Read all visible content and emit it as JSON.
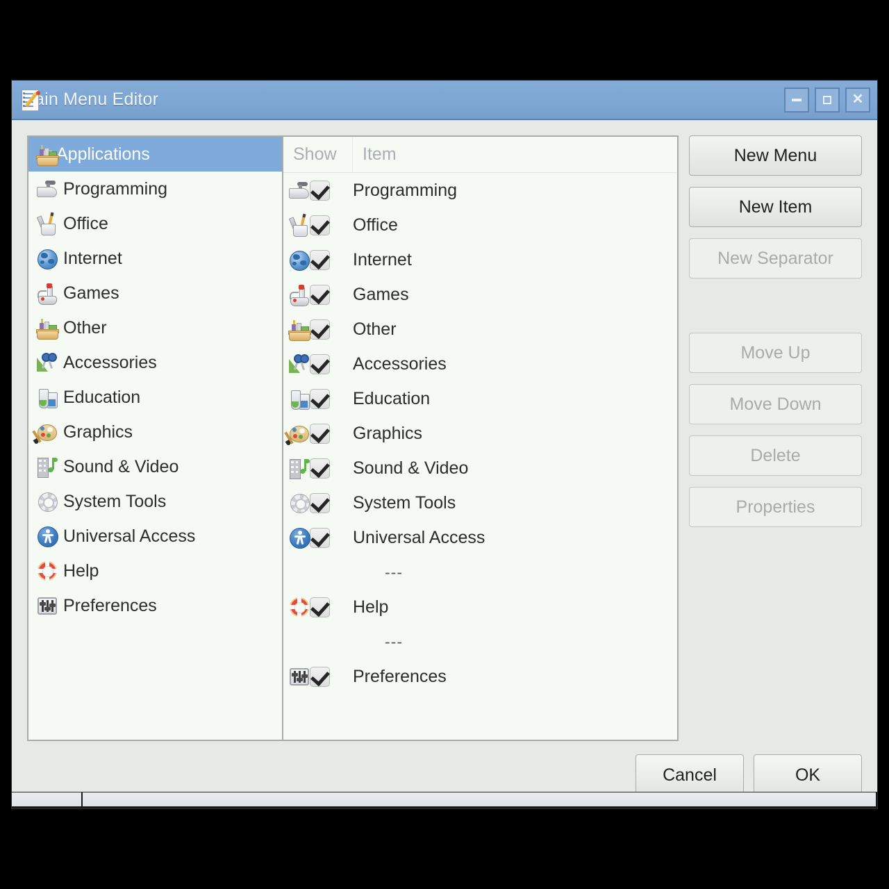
{
  "window": {
    "title": "Main Menu Editor",
    "title_icon": "menu-editor-icon",
    "controls": {
      "minimize": "minimize-icon",
      "maximize": "maximize-icon",
      "close": "close-icon"
    }
  },
  "tree": {
    "root": {
      "label": "Applications",
      "icon": "toolbox-icon",
      "expanded": true,
      "selected": true
    },
    "children": [
      {
        "label": "Programming",
        "icon": "trowel-icon"
      },
      {
        "label": "Office",
        "icon": "pencil-cup-icon"
      },
      {
        "label": "Internet",
        "icon": "globe-icon"
      },
      {
        "label": "Games",
        "icon": "joystick-icon"
      },
      {
        "label": "Other",
        "icon": "toolbox-icon"
      },
      {
        "label": "Accessories",
        "icon": "scissors-ruler-icon"
      },
      {
        "label": "Education",
        "icon": "flask-icon"
      },
      {
        "label": "Graphics",
        "icon": "palette-icon"
      },
      {
        "label": "Sound & Video",
        "icon": "film-note-icon"
      },
      {
        "label": "System Tools",
        "icon": "gear-icon"
      },
      {
        "label": "Universal Access",
        "icon": "accessibility-icon"
      },
      {
        "label": "Help",
        "icon": "lifebuoy-icon"
      },
      {
        "label": "Preferences",
        "icon": "sliders-icon"
      }
    ]
  },
  "list": {
    "columns": {
      "show": "Show",
      "item": "Item"
    },
    "rows": [
      {
        "type": "item",
        "checked": true,
        "icon": "trowel-icon",
        "label": "Programming"
      },
      {
        "type": "item",
        "checked": true,
        "icon": "pencil-cup-icon",
        "label": "Office"
      },
      {
        "type": "item",
        "checked": true,
        "icon": "globe-icon",
        "label": "Internet"
      },
      {
        "type": "item",
        "checked": true,
        "icon": "joystick-icon",
        "label": "Games"
      },
      {
        "type": "item",
        "checked": true,
        "icon": "toolbox-icon",
        "label": "Other"
      },
      {
        "type": "item",
        "checked": true,
        "icon": "scissors-ruler-icon",
        "label": "Accessories"
      },
      {
        "type": "item",
        "checked": true,
        "icon": "flask-icon",
        "label": "Education"
      },
      {
        "type": "item",
        "checked": true,
        "icon": "palette-icon",
        "label": "Graphics"
      },
      {
        "type": "item",
        "checked": true,
        "icon": "film-note-icon",
        "label": "Sound & Video"
      },
      {
        "type": "item",
        "checked": true,
        "icon": "gear-icon",
        "label": "System Tools"
      },
      {
        "type": "item",
        "checked": true,
        "icon": "accessibility-icon",
        "label": "Universal Access"
      },
      {
        "type": "separator",
        "checked": false,
        "icon": "",
        "label": "---"
      },
      {
        "type": "item",
        "checked": true,
        "icon": "lifebuoy-icon",
        "label": "Help"
      },
      {
        "type": "separator",
        "checked": false,
        "icon": "",
        "label": "---"
      },
      {
        "type": "item",
        "checked": true,
        "icon": "sliders-icon",
        "label": "Preferences"
      }
    ]
  },
  "side_buttons": {
    "new_menu": {
      "label": "New Menu",
      "enabled": true
    },
    "new_item": {
      "label": "New Item",
      "enabled": true
    },
    "new_separator": {
      "label": "New Separator",
      "enabled": false
    },
    "move_up": {
      "label": "Move Up",
      "enabled": false
    },
    "move_down": {
      "label": "Move Down",
      "enabled": false
    },
    "delete": {
      "label": "Delete",
      "enabled": false
    },
    "properties": {
      "label": "Properties",
      "enabled": false
    }
  },
  "footer": {
    "cancel": "Cancel",
    "ok": "OK"
  },
  "colors": {
    "titlebar": "#7ea7d4",
    "selection": "#7eabdb",
    "dialog_bg": "#e6eae6",
    "panel_bg": "#f5faf5",
    "disabled_text": "#a8aca8",
    "taskbar": "#c8c8d8"
  }
}
